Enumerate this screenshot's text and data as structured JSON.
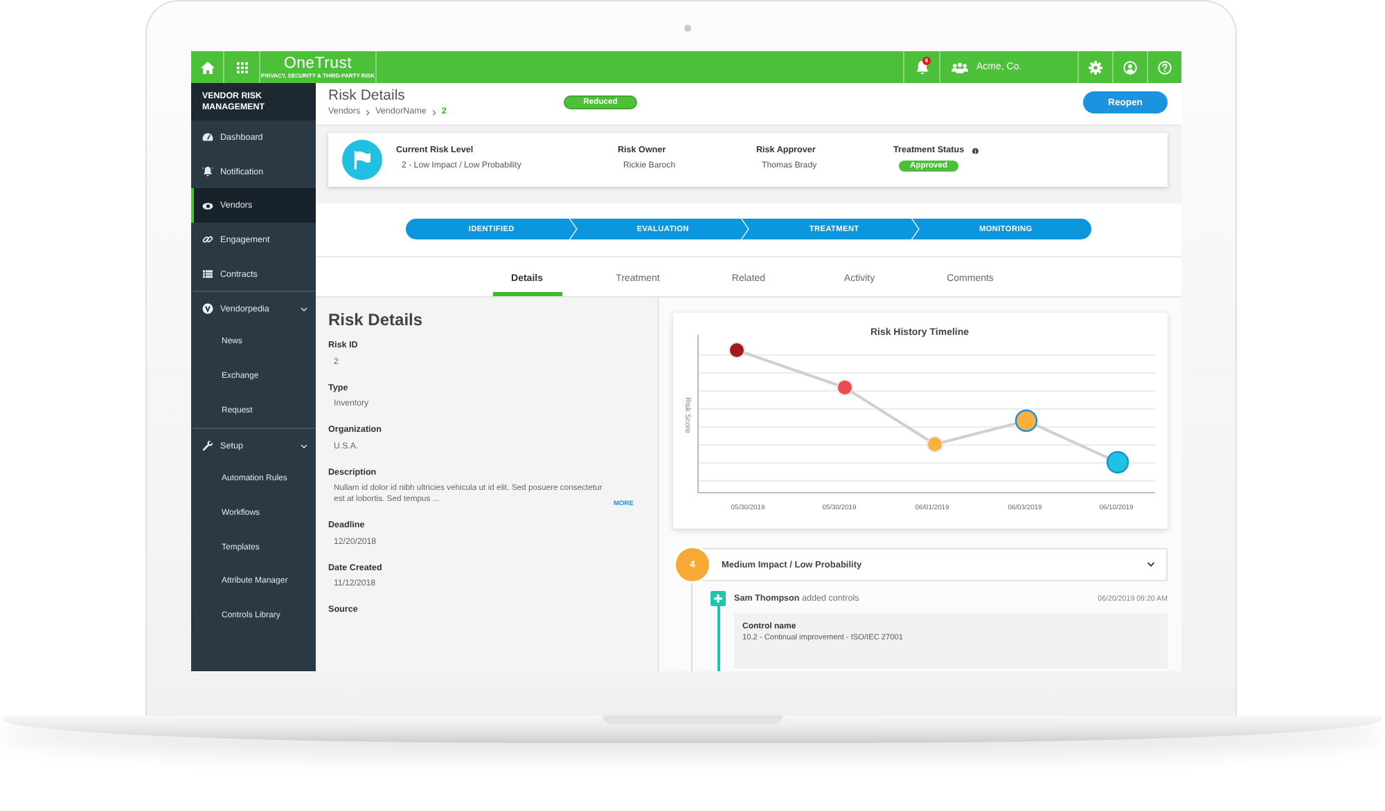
{
  "top_bar": {
    "logo": "OneTrust",
    "tagline": "PRIVACY, SECURITY & THIRD-PARTY RISK",
    "notification_count": "6",
    "organization": "Acme, Co."
  },
  "sidebar": {
    "title": "VENDOR RISK MANAGEMENT",
    "items": [
      {
        "label": "Dashboard",
        "kind": "link",
        "selected": false
      },
      {
        "label": "Notification",
        "kind": "link",
        "selected": false
      },
      {
        "label": "Vendors",
        "kind": "link",
        "selected": true
      },
      {
        "label": "Engagement",
        "kind": "link",
        "selected": false
      },
      {
        "label": "Contracts",
        "kind": "link",
        "selected": false
      },
      {
        "label": "Vendorpedia",
        "kind": "group",
        "selected": false,
        "expanded": true,
        "children": [
          {
            "label": "News",
            "selected": false
          },
          {
            "label": "Exchange",
            "selected": false
          },
          {
            "label": "Request",
            "selected": false
          }
        ]
      },
      {
        "label": "Setup",
        "kind": "group",
        "selected": false,
        "expanded": true,
        "children": [
          {
            "label": "Automation Rules",
            "selected": false
          },
          {
            "label": "Workflows",
            "selected": false
          },
          {
            "label": "Templates",
            "selected": false
          },
          {
            "label": "Attribute Manager",
            "selected": false
          },
          {
            "label": "Controls Library",
            "selected": false
          }
        ]
      }
    ]
  },
  "page_header": {
    "title": "Risk Details",
    "breadcrumb": [
      {
        "label": "Vendors",
        "current": false
      },
      {
        "label": "VendorName",
        "current": false
      },
      {
        "label": "2",
        "current": true
      }
    ],
    "status": "Reduced",
    "action": "Reopen"
  },
  "summary": {
    "fields": [
      {
        "label": "Current Risk Level",
        "value": "2 - Low Impact / Low Probability",
        "kind": "text",
        "info": false
      },
      {
        "label": "Risk Owner",
        "value": "Rickie Baroch",
        "kind": "text",
        "info": false
      },
      {
        "label": "Risk Approver",
        "value": "Thomas Brady",
        "kind": "text",
        "info": false
      },
      {
        "label": "Treatment Status",
        "value": "Approved",
        "kind": "badge",
        "info": true
      }
    ]
  },
  "stages": [
    {
      "label": "IDENTIFIED"
    },
    {
      "label": "EVALUATION"
    },
    {
      "label": "TREATMENT"
    },
    {
      "label": "MONITORING"
    }
  ],
  "tabs": [
    {
      "label": "Details",
      "selected": true
    },
    {
      "label": "Treatment",
      "selected": false
    },
    {
      "label": "Related",
      "selected": false
    },
    {
      "label": "Activity",
      "selected": false
    },
    {
      "label": "Comments",
      "selected": false
    }
  ],
  "risk_details": {
    "title": "Risk Details",
    "fields": [
      {
        "label": "Risk ID",
        "value": "2"
      },
      {
        "label": "Type",
        "value": "Inventory"
      },
      {
        "label": "Organization",
        "value": "U.S.A."
      },
      {
        "label": "Description",
        "value": "Nullam id dolor id nibh ultricies vehicula ut id elit. Sed posuere consectetur est at lobortis. Sed tempus ...",
        "link": "MORE"
      },
      {
        "label": "Deadline",
        "value": "12/20/2018"
      },
      {
        "label": "Date Created",
        "value": "11/12/2018"
      },
      {
        "label": "Source"
      }
    ]
  },
  "chart": {
    "title": "Risk History Timeline",
    "ylabel": "Risk Score",
    "points": [
      {
        "label": "05/30/2019",
        "color": "#a5191d",
        "highlighted": false
      },
      {
        "label": "05/30/2019",
        "color": "#eb4b50",
        "highlighted": false
      },
      {
        "label": "06/01/2019",
        "color": "#f8b03f",
        "highlighted": false
      },
      {
        "label": "06/03/2019",
        "color": "#f8b03f",
        "highlighted": true
      },
      {
        "label": "06/10/2019",
        "color": "#1cc4e2",
        "highlighted": true
      }
    ]
  },
  "timeline": {
    "groups": [
      {
        "badge": "4",
        "color": "#f6a935",
        "title": "Medium Impact / Low Probability",
        "expanded": true,
        "entries": [
          {
            "summary": "**Sam Thompson** added controls",
            "time": "06/20/2019 09:20 AM",
            "detail_label": "Control name",
            "detail_value": "10.2 - Continual improvement - ISO/IEC 27001"
          }
        ]
      }
    ]
  }
}
